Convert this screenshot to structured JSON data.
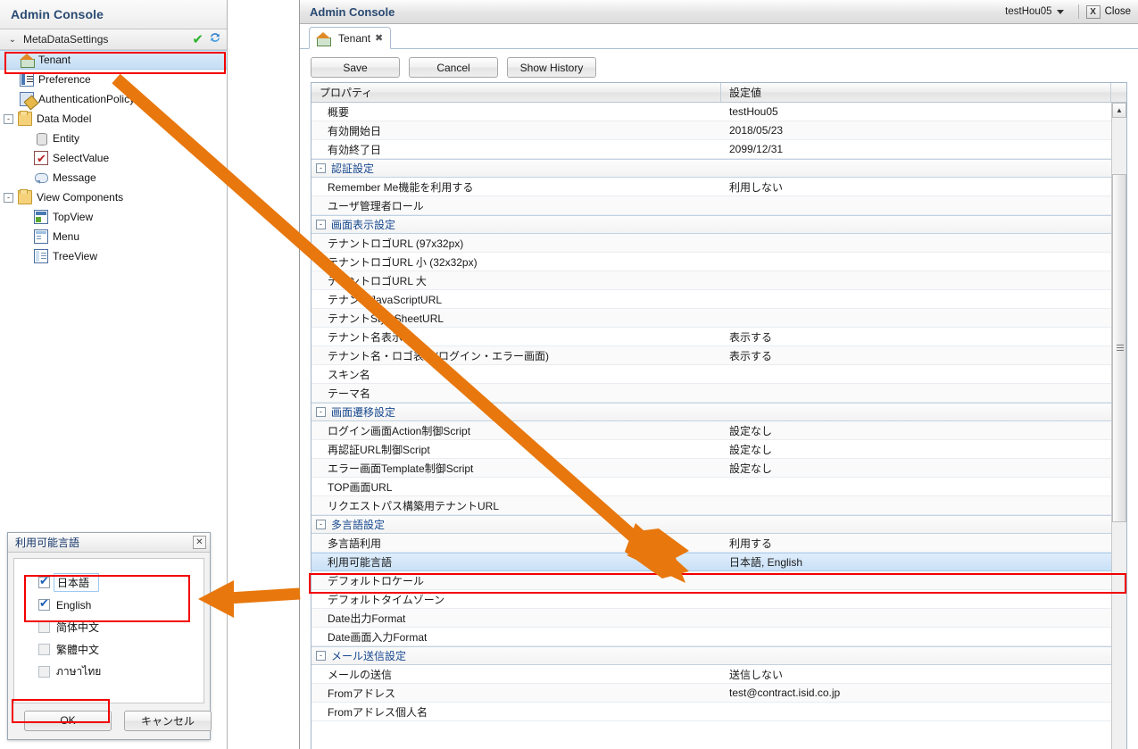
{
  "colors": {
    "accent_orange": "#e8770d",
    "annotation_red": "#f20000",
    "title_blue": "#2a4a72",
    "group_blue": "#17488f",
    "selection_blue": "#c9e0f6"
  },
  "sidebar": {
    "title": "Admin Console",
    "meta_group": {
      "label": "MetaDataSettings",
      "chevron": "⌄",
      "check_icon": "check-icon",
      "refresh_icon": "refresh-icon"
    },
    "items": [
      {
        "label": "Tenant",
        "icon": "home-icon",
        "indent": 1,
        "selected": true,
        "expander": ""
      },
      {
        "label": "Preference",
        "icon": "preference-icon",
        "indent": 1,
        "selected": false,
        "expander": ""
      },
      {
        "label": "AuthenticationPolicy",
        "icon": "authentication-policy-icon",
        "indent": 1,
        "selected": false,
        "expander": ""
      },
      {
        "label": "Data Model",
        "icon": "folder-icon",
        "indent": 0,
        "selected": false,
        "expander": "-"
      },
      {
        "label": "Entity",
        "icon": "entity-icon",
        "indent": 2,
        "selected": false,
        "expander": ""
      },
      {
        "label": "SelectValue",
        "icon": "select-value-icon",
        "indent": 2,
        "selected": false,
        "expander": ""
      },
      {
        "label": "Message",
        "icon": "message-icon",
        "indent": 2,
        "selected": false,
        "expander": ""
      },
      {
        "label": "View Components",
        "icon": "folder-icon",
        "indent": 0,
        "selected": false,
        "expander": "-"
      },
      {
        "label": "TopView",
        "icon": "topview-icon",
        "indent": 2,
        "selected": false,
        "expander": ""
      },
      {
        "label": "Menu",
        "icon": "menu-icon",
        "indent": 2,
        "selected": false,
        "expander": ""
      },
      {
        "label": "TreeView",
        "icon": "treeview-icon",
        "indent": 2,
        "selected": false,
        "expander": ""
      }
    ]
  },
  "main": {
    "title": "Admin Console",
    "user": "testHou05",
    "close_label": "Close",
    "close_icon_glyph": "X",
    "tab": {
      "label": "Tenant",
      "icon": "home-icon",
      "close_glyph": "✖"
    },
    "toolbar": {
      "save_label": "Save",
      "cancel_label": "Cancel",
      "history_label": "Show History"
    },
    "grid": {
      "col_property": "プロパティ",
      "col_value": "設定値",
      "rows": [
        {
          "type": "data",
          "property": "概要",
          "value": "testHou05"
        },
        {
          "type": "data",
          "property": "有効開始日",
          "value": "2018/05/23"
        },
        {
          "type": "data",
          "property": "有効終了日",
          "value": "2099/12/31"
        },
        {
          "type": "group",
          "property": "認証設定",
          "value": "",
          "expander": "-"
        },
        {
          "type": "data",
          "property": "Remember Me機能を利用する",
          "value": "利用しない"
        },
        {
          "type": "data",
          "property": "ユーザ管理者ロール",
          "value": ""
        },
        {
          "type": "group",
          "property": "画面表示設定",
          "value": "",
          "expander": "-"
        },
        {
          "type": "data",
          "property": "テナントロゴURL (97x32px)",
          "value": ""
        },
        {
          "type": "data",
          "property": "テナントロゴURL 小 (32x32px)",
          "value": ""
        },
        {
          "type": "data",
          "property": "テナントロゴURL 大",
          "value": ""
        },
        {
          "type": "data",
          "property": "テナントJavaScriptURL",
          "value": ""
        },
        {
          "type": "data",
          "property": "テナントStyleSheetURL",
          "value": ""
        },
        {
          "type": "data",
          "property": "テナント名表示",
          "value": "表示する"
        },
        {
          "type": "data",
          "property": "テナント名・ロゴ表示(ログイン・エラー画面)",
          "value": "表示する"
        },
        {
          "type": "data",
          "property": "スキン名",
          "value": ""
        },
        {
          "type": "data",
          "property": "テーマ名",
          "value": ""
        },
        {
          "type": "group",
          "property": "画面遷移設定",
          "value": "",
          "expander": "-"
        },
        {
          "type": "data",
          "property": "ログイン画面Action制御Script",
          "value": "設定なし"
        },
        {
          "type": "data",
          "property": "再認証URL制御Script",
          "value": "設定なし"
        },
        {
          "type": "data",
          "property": "エラー画面Template制御Script",
          "value": "設定なし"
        },
        {
          "type": "data",
          "property": "TOP画面URL",
          "value": ""
        },
        {
          "type": "data",
          "property": "リクエストパス構築用テナントURL",
          "value": ""
        },
        {
          "type": "group",
          "property": "多言語設定",
          "value": "",
          "expander": "-"
        },
        {
          "type": "data",
          "property": "多言語利用",
          "value": "利用する"
        },
        {
          "type": "data",
          "property": "利用可能言語",
          "value": "日本語, English",
          "selected": true
        },
        {
          "type": "data",
          "property": "デフォルトロケール",
          "value": ""
        },
        {
          "type": "data",
          "property": "デフォルトタイムゾーン",
          "value": ""
        },
        {
          "type": "data",
          "property": "Date出力Format",
          "value": ""
        },
        {
          "type": "data",
          "property": "Date画面入力Format",
          "value": ""
        },
        {
          "type": "group",
          "property": "メール送信設定",
          "value": "",
          "expander": "-"
        },
        {
          "type": "data",
          "property": "メールの送信",
          "value": "送信しない"
        },
        {
          "type": "data",
          "property": "Fromアドレス",
          "value": "test@contract.isid.co.jp"
        },
        {
          "type": "data",
          "property": "Fromアドレス個人名",
          "value": ""
        }
      ]
    }
  },
  "dialog": {
    "title": "利用可能言語",
    "close_glyph": "✕",
    "options": [
      {
        "label": "日本語",
        "checked": true,
        "enabled": true,
        "focused": true
      },
      {
        "label": "English",
        "checked": true,
        "enabled": true,
        "focused": false
      },
      {
        "label": "简体中文",
        "checked": false,
        "enabled": false,
        "focused": false
      },
      {
        "label": "繁體中文",
        "checked": false,
        "enabled": false,
        "focused": false
      },
      {
        "label": "ภาษาไทย",
        "checked": false,
        "enabled": false,
        "focused": false
      }
    ],
    "ok_label": "OK",
    "cancel_label": "キャンセル"
  }
}
